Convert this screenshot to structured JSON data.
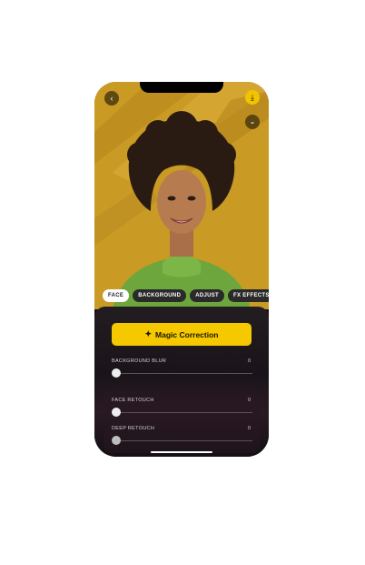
{
  "top_bar": {
    "back_icon": "back-arrow-icon",
    "download_icon": "download-icon",
    "collapse_icon": "chevron-down-icon"
  },
  "tabs": [
    {
      "label": "FACE",
      "active": true
    },
    {
      "label": "BACKGROUND",
      "active": false
    },
    {
      "label": "ADJUST",
      "active": false
    },
    {
      "label": "FX EFFECTS",
      "active": false
    }
  ],
  "magic_button": {
    "label": "Magic Correction",
    "icon": "magic-wand-icon"
  },
  "sliders": [
    {
      "label": "BACKGROUND BLUR",
      "value": "0"
    },
    {
      "label": "FACE RETOUCH",
      "value": "0"
    },
    {
      "label": "DEEP RETOUCH",
      "value": "0"
    }
  ],
  "colors": {
    "accent": "#f6c800",
    "photo_background": "#c99a24",
    "panel_background": "#1c161a",
    "sweater": "#6ea63e"
  }
}
